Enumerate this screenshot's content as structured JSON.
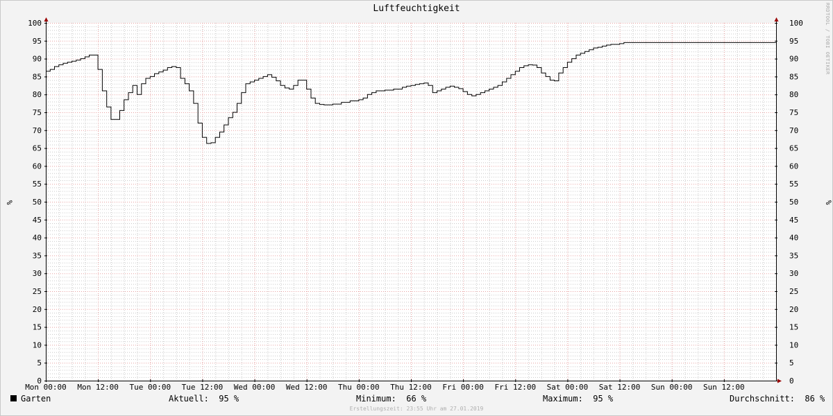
{
  "chart_data": {
    "type": "line",
    "title": "Luftfeuchtigkeit",
    "ylabel": "%",
    "ylim": [
      0,
      100
    ],
    "yticks": [
      0,
      5,
      10,
      15,
      20,
      25,
      30,
      35,
      40,
      45,
      50,
      55,
      60,
      65,
      70,
      75,
      80,
      85,
      90,
      95,
      100
    ],
    "xlim": [
      0,
      168
    ],
    "xticks": [
      {
        "label": "Mon 00:00",
        "hour": 0
      },
      {
        "label": "Mon 12:00",
        "hour": 12
      },
      {
        "label": "Tue 00:00",
        "hour": 24
      },
      {
        "label": "Tue 12:00",
        "hour": 36
      },
      {
        "label": "Wed 00:00",
        "hour": 48
      },
      {
        "label": "Wed 12:00",
        "hour": 60
      },
      {
        "label": "Thu 00:00",
        "hour": 72
      },
      {
        "label": "Thu 12:00",
        "hour": 84
      },
      {
        "label": "Fri 00:00",
        "hour": 96
      },
      {
        "label": "Fri 12:00",
        "hour": 108
      },
      {
        "label": "Sat 00:00",
        "hour": 120
      },
      {
        "label": "Sat 12:00",
        "hour": 132
      },
      {
        "label": "Sun 00:00",
        "hour": 144
      },
      {
        "label": "Sun 12:00",
        "hour": 156
      }
    ],
    "grid": true,
    "series": [
      {
        "name": "Garten",
        "color": "#000000",
        "x_hours": [
          0,
          1,
          2,
          3,
          4,
          5,
          6,
          7,
          8,
          9,
          10,
          11,
          12,
          13,
          14,
          15,
          16,
          17,
          18,
          19,
          20,
          21,
          22,
          23,
          24,
          25,
          26,
          27,
          28,
          29,
          30,
          31,
          32,
          33,
          34,
          35,
          36,
          37,
          38,
          39,
          40,
          41,
          42,
          43,
          44,
          45,
          46,
          47,
          48,
          49,
          50,
          51,
          52,
          53,
          54,
          55,
          56,
          57,
          58,
          59,
          60,
          61,
          62,
          63,
          64,
          66,
          68,
          70,
          72,
          73,
          74,
          75,
          76,
          78,
          80,
          82,
          83,
          84,
          85,
          86,
          87,
          88,
          89,
          90,
          91,
          92,
          93,
          94,
          95,
          96,
          97,
          98,
          99,
          100,
          101,
          102,
          103,
          104,
          105,
          106,
          107,
          108,
          109,
          110,
          111,
          112,
          113,
          114,
          115,
          116,
          117,
          118,
          119,
          120,
          121,
          122,
          123,
          124,
          125,
          126,
          127,
          128,
          129,
          130,
          131,
          132,
          133,
          134,
          168
        ],
        "values": [
          86.5,
          87,
          87.8,
          88.3,
          88.7,
          89,
          89.3,
          89.6,
          90,
          90.5,
          91,
          91,
          87,
          81,
          76.5,
          73,
          73,
          75.5,
          78.5,
          80.5,
          82.5,
          80,
          83,
          84.5,
          85,
          85.8,
          86.3,
          86.8,
          87.5,
          87.8,
          87.5,
          84.5,
          83,
          81,
          77.5,
          72,
          68,
          66.3,
          66.5,
          68,
          69.5,
          71.5,
          73.5,
          75,
          77.5,
          80.5,
          83,
          83.5,
          84,
          84.5,
          85,
          85.5,
          84.8,
          83.8,
          82.5,
          81.8,
          81.5,
          82.5,
          84,
          84,
          81.5,
          79,
          77.5,
          77.2,
          77.1,
          77.3,
          77.8,
          78.2,
          78.5,
          79,
          80,
          80.5,
          81,
          81.2,
          81.5,
          82,
          82.3,
          82.5,
          82.8,
          83,
          83.2,
          82.5,
          80.5,
          81,
          81.5,
          82,
          82.3,
          82,
          81.6,
          80.8,
          80,
          79.6,
          80,
          80.5,
          81,
          81.5,
          82,
          82.5,
          83.5,
          84.5,
          85.5,
          86.5,
          87.5,
          88,
          88.3,
          88.2,
          87.5,
          86,
          85,
          84,
          83.8,
          86,
          87.5,
          89,
          90,
          91,
          91.5,
          92,
          92.5,
          93,
          93.2,
          93.5,
          93.8,
          94,
          94,
          94.2,
          94.5,
          94.5,
          94.5
        ]
      }
    ]
  },
  "vertical_credit": "RRDTOOL / TOBI OETIKER",
  "legend": {
    "series_name": "Garten",
    "aktuell_label": "Aktuell:",
    "aktuell_value": "95 %",
    "minimum_label": "Minimum:",
    "minimum_value": "66 %",
    "maximum_label": "Maximum:",
    "maximum_value": "95 %",
    "durchschnitt_label": "Durchschnitt:",
    "durchschnitt_value": "86 %"
  },
  "timestamp": "Erstellungszeit: 23:55 Uhr am 27.01.2019",
  "colors": {
    "background": "#f3f3f3",
    "plot_background": "#ffffff",
    "minor_grid": "#c8c8c8",
    "major_grid": "#e8a0a0",
    "line": "#000000",
    "arrow": "#990000"
  }
}
